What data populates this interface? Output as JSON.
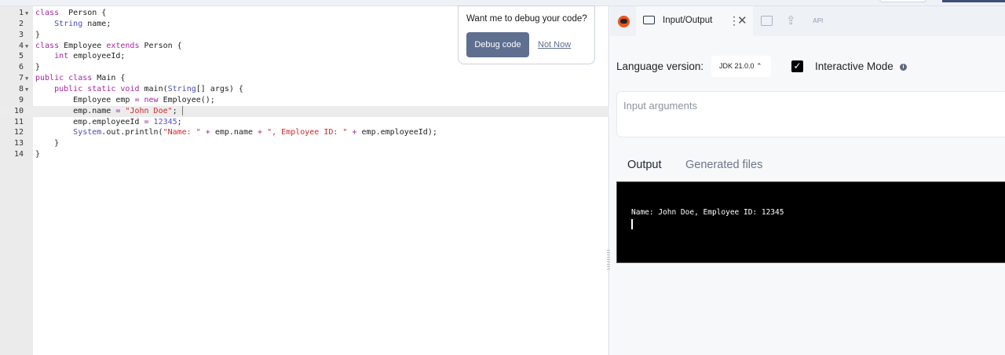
{
  "editor": {
    "active_line": 10,
    "lines": [
      {
        "n": "1",
        "fold": true,
        "tokens": [
          [
            "kw",
            "class"
          ],
          [
            "",
            "  Person {"
          ]
        ]
      },
      {
        "n": "2",
        "fold": false,
        "tokens": [
          [
            "",
            "    "
          ],
          [
            "ty",
            "String"
          ],
          [
            "",
            " name;"
          ]
        ]
      },
      {
        "n": "3",
        "fold": false,
        "tokens": [
          [
            "",
            "}"
          ]
        ]
      },
      {
        "n": "4",
        "fold": true,
        "tokens": [
          [
            "kw",
            "class"
          ],
          [
            "",
            " Employee "
          ],
          [
            "kw",
            "extends"
          ],
          [
            "",
            " Person {"
          ]
        ]
      },
      {
        "n": "5",
        "fold": false,
        "tokens": [
          [
            "",
            "    "
          ],
          [
            "kw",
            "int"
          ],
          [
            "",
            " employeeId;"
          ]
        ]
      },
      {
        "n": "6",
        "fold": false,
        "tokens": [
          [
            "",
            "}"
          ]
        ]
      },
      {
        "n": "7",
        "fold": true,
        "tokens": [
          [
            "kw",
            "public"
          ],
          [
            "",
            " "
          ],
          [
            "kw",
            "class"
          ],
          [
            "",
            " Main {"
          ]
        ]
      },
      {
        "n": "8",
        "fold": true,
        "tokens": [
          [
            "",
            "    "
          ],
          [
            "kw",
            "public"
          ],
          [
            "",
            " "
          ],
          [
            "kw",
            "static"
          ],
          [
            "",
            " "
          ],
          [
            "kw",
            "void"
          ],
          [
            "",
            " main("
          ],
          [
            "ty",
            "String"
          ],
          [
            "",
            "[] args) {"
          ]
        ]
      },
      {
        "n": "9",
        "fold": false,
        "tokens": [
          [
            "",
            "        Employee emp "
          ],
          [
            "op",
            "="
          ],
          [
            "",
            " "
          ],
          [
            "kw",
            "new"
          ],
          [
            "",
            " Employee();"
          ]
        ]
      },
      {
        "n": "10",
        "fold": false,
        "tokens": [
          [
            "",
            "        emp.name "
          ],
          [
            "op",
            "="
          ],
          [
            "",
            " "
          ],
          [
            "st",
            "\"John Doe\""
          ],
          [
            "",
            ";"
          ]
        ]
      },
      {
        "n": "11",
        "fold": false,
        "tokens": [
          [
            "",
            "        emp.employeeId "
          ],
          [
            "op",
            "="
          ],
          [
            "",
            " "
          ],
          [
            "nu",
            "12345"
          ],
          [
            "",
            ";"
          ]
        ]
      },
      {
        "n": "12",
        "fold": false,
        "tokens": [
          [
            "",
            "        "
          ],
          [
            "ty",
            "System"
          ],
          [
            "",
            ".out.println("
          ],
          [
            "st",
            "\"Name: \""
          ],
          [
            "",
            " "
          ],
          [
            "op",
            "+"
          ],
          [
            "",
            " emp.name "
          ],
          [
            "op",
            "+"
          ],
          [
            "",
            " "
          ],
          [
            "st",
            "\", Employee ID: \""
          ],
          [
            "",
            " "
          ],
          [
            "op",
            "+"
          ],
          [
            "",
            " emp.employeeId);"
          ]
        ]
      },
      {
        "n": "13",
        "fold": false,
        "tokens": [
          [
            "",
            "    }"
          ]
        ]
      },
      {
        "n": "14",
        "fold": false,
        "tokens": [
          [
            "",
            "}"
          ]
        ]
      }
    ]
  },
  "popup": {
    "question": "Want me to debug your code?",
    "debug_label": "Debug code",
    "not_now_label": "Not Now"
  },
  "tabs": {
    "io_label": "Input/Output",
    "api_label": "API"
  },
  "settings": {
    "language_label": "Language version:",
    "language_value": "JDK 21.0.0 ⌃",
    "interactive_label": "Interactive Mode",
    "interactive_checked": true,
    "info": "i"
  },
  "args": {
    "placeholder": "Input arguments"
  },
  "output_tabs": {
    "output": "Output",
    "generated": "Generated files"
  },
  "terminal": {
    "text": "Name: John Doe, Employee ID: 12345"
  },
  "colors": {
    "button": "#5e6f90",
    "terminal_bg": "#000000"
  }
}
